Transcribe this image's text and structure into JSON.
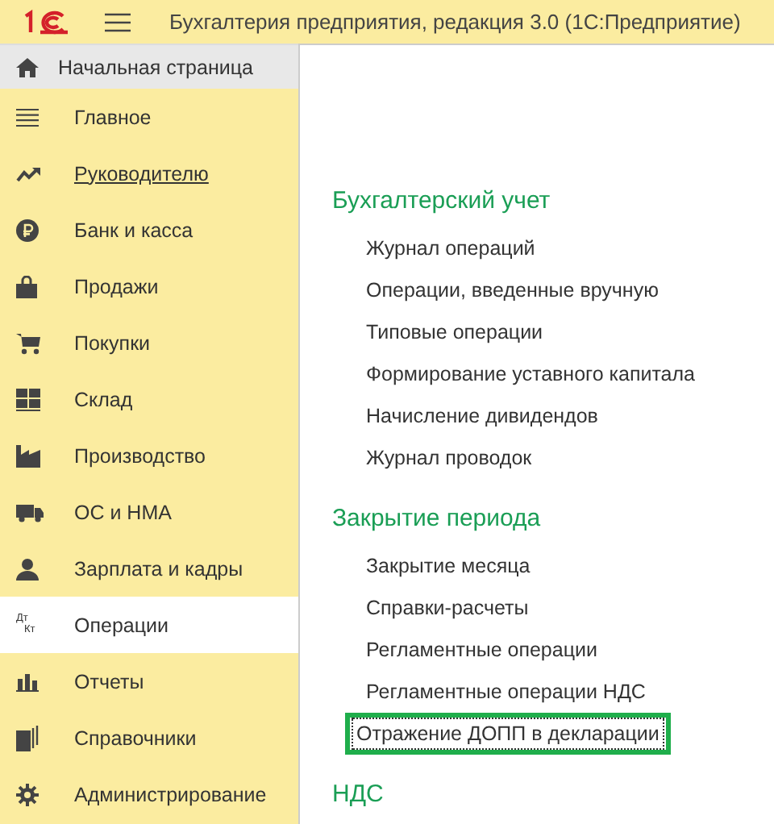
{
  "window": {
    "title": "Бухгалтерия предприятия, редакция 3.0  (1С:Предприятие)"
  },
  "home_tab": {
    "label": "Начальная страница"
  },
  "sidebar": {
    "items": [
      {
        "label": "Главное",
        "kind": "menu",
        "selected": false,
        "hovered": false
      },
      {
        "label": "Руководителю",
        "kind": "trend",
        "selected": false,
        "hovered": true
      },
      {
        "label": "Банк и касса",
        "kind": "ruble",
        "selected": false,
        "hovered": false
      },
      {
        "label": "Продажи",
        "kind": "bag",
        "selected": false,
        "hovered": false
      },
      {
        "label": "Покупки",
        "kind": "cart",
        "selected": false,
        "hovered": false
      },
      {
        "label": "Склад",
        "kind": "warehouse",
        "selected": false,
        "hovered": false
      },
      {
        "label": "Производство",
        "kind": "factory",
        "selected": false,
        "hovered": false
      },
      {
        "label": "ОС и НМА",
        "kind": "truck",
        "selected": false,
        "hovered": false
      },
      {
        "label": "Зарплата и кадры",
        "kind": "person",
        "selected": false,
        "hovered": false
      },
      {
        "label": "Операции",
        "kind": "dtkt",
        "icon_text": [
          "Дт",
          "Кт"
        ],
        "selected": true,
        "hovered": false
      },
      {
        "label": "Отчеты",
        "kind": "bars",
        "selected": false,
        "hovered": false
      },
      {
        "label": "Справочники",
        "kind": "books",
        "selected": false,
        "hovered": false
      },
      {
        "label": "Администрирование",
        "kind": "gear",
        "selected": false,
        "hovered": false
      }
    ]
  },
  "sections": [
    {
      "title": "Бухгалтерский учет",
      "links": [
        {
          "label": "Журнал операций",
          "focused": false
        },
        {
          "label": "Операции, введенные вручную",
          "focused": false
        },
        {
          "label": "Типовые операции",
          "focused": false
        },
        {
          "label": "Формирование уставного капитала",
          "focused": false
        },
        {
          "label": "Начисление дивидендов",
          "focused": false
        },
        {
          "label": "Журнал проводок",
          "focused": false
        }
      ]
    },
    {
      "title": "Закрытие периода",
      "links": [
        {
          "label": "Закрытие месяца",
          "focused": false
        },
        {
          "label": "Справки-расчеты",
          "focused": false
        },
        {
          "label": "Регламентные операции",
          "focused": false
        },
        {
          "label": "Регламентные операции НДС",
          "focused": false
        },
        {
          "label": "Отражение ДОПП в декларации",
          "focused": true
        }
      ]
    },
    {
      "title": "НДС"
    }
  ]
}
